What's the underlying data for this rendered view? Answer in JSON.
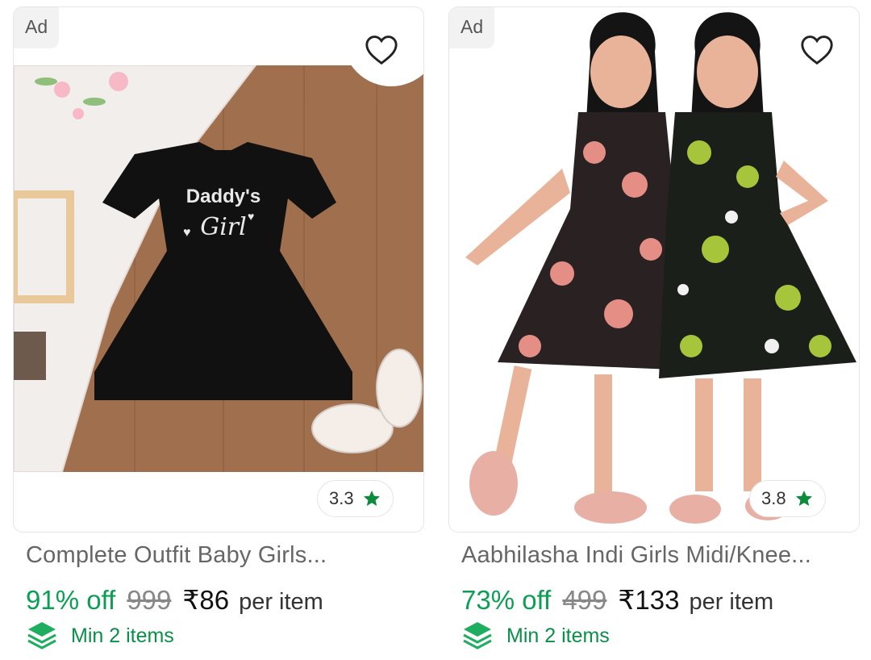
{
  "products": [
    {
      "ad_label": "Ad",
      "title": "Complete Outfit Baby Girls...",
      "discount": "91% off",
      "mrp": "999",
      "price": "₹86",
      "per_unit": "per item",
      "rating": "3.3",
      "min_label": "Min 2 items",
      "image_text_top": "Daddy's",
      "image_text_bottom": "Girl"
    },
    {
      "ad_label": "Ad",
      "title": "Aabhilasha Indi Girls Midi/Knee...",
      "discount": "73% off",
      "mrp": "499",
      "price": "₹133",
      "per_unit": "per item",
      "rating": "3.8",
      "min_label": "Min 2 items"
    }
  ],
  "colors": {
    "discount_green": "#0a9f54",
    "star_green": "#0b8b3b",
    "min_green": "#0a8f49"
  },
  "icons": {
    "wishlist": "heart-outline-icon",
    "rating": "star-icon",
    "min_qty": "stack-layers-icon"
  }
}
